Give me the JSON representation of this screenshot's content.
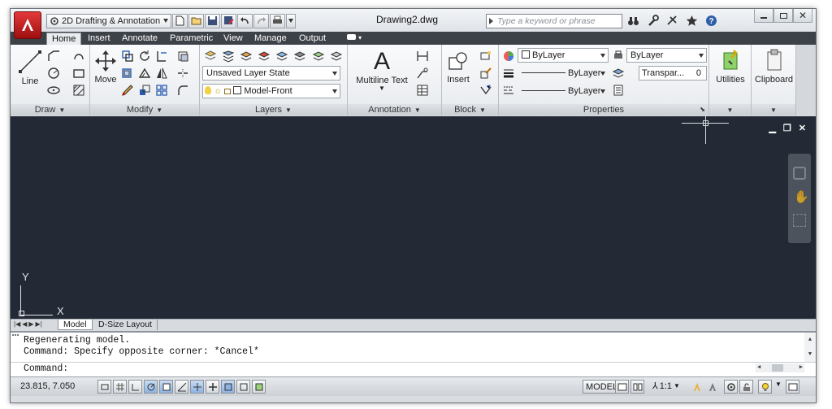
{
  "titlebar": {
    "workspace": "2D Drafting & Annotation",
    "document_title": "Drawing2.dwg",
    "search_placeholder": "Type a keyword or phrase"
  },
  "tabs": [
    "Home",
    "Insert",
    "Annotate",
    "Parametric",
    "View",
    "Manage",
    "Output"
  ],
  "panels": {
    "draw": {
      "title": "Draw",
      "line_label": "Line"
    },
    "modify": {
      "title": "Modify",
      "move_label": "Move"
    },
    "layers": {
      "title": "Layers",
      "layer_state": "Unsaved Layer State",
      "current_layer": "Model-Front"
    },
    "annotation": {
      "title": "Annotation",
      "text_label": "Multiline Text",
      "big_glyph": "A"
    },
    "block": {
      "title": "Block",
      "insert_label": "Insert"
    },
    "properties": {
      "title": "Properties",
      "color": "ByLayer",
      "lineweight": "ByLayer",
      "linetype": "ByLayer",
      "plotstyle": "ByLayer",
      "transparency_label": "Transpar...",
      "transparency_value": "0"
    },
    "utilities": {
      "label": "Utilities"
    },
    "clipboard": {
      "label": "Clipboard"
    }
  },
  "canvas": {
    "ucs_x": "X",
    "ucs_y": "Y",
    "bg_color": "#242a35"
  },
  "layout_tabs": [
    "Model",
    "D-Size Layout"
  ],
  "command": {
    "history": [
      "Regenerating model.",
      "Command: Specify opposite corner: *Cancel*"
    ],
    "prompt": "Command:"
  },
  "status": {
    "coordinates": "23.815, 7.050",
    "space": "MODEL",
    "scale": "1:1"
  }
}
